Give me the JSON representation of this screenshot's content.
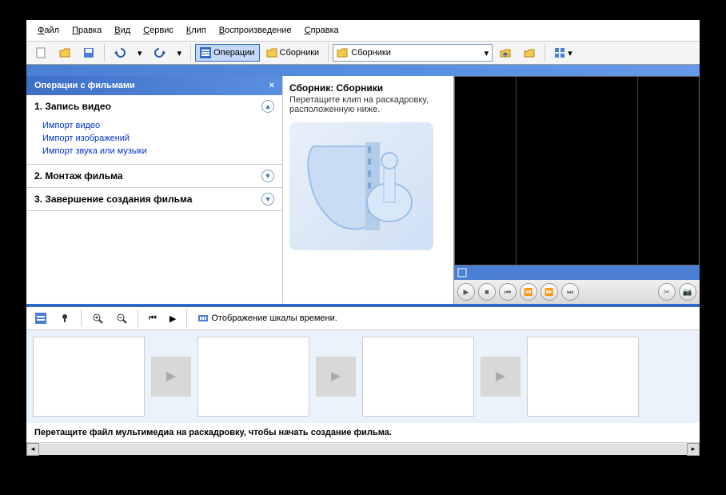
{
  "menu": {
    "file": "Файл",
    "edit": "Правка",
    "view": "Вид",
    "service": "Сервис",
    "clip": "Клип",
    "play": "Воспроизведение",
    "help": "Справка"
  },
  "toolbar": {
    "operations": "Операции",
    "collections": "Сборники",
    "location_value": "Сборники"
  },
  "tasks": {
    "header": "Операции с фильмами",
    "group1": {
      "title": "1. Запись видео",
      "links": {
        "a": "Импорт видео",
        "b": "Импорт изображений",
        "c": "Импорт звука или музыки"
      }
    },
    "group2": {
      "title": "2. Монтаж фильма"
    },
    "group3": {
      "title": "3. Завершение создания фильма"
    }
  },
  "collection": {
    "title": "Сборник: Сборники",
    "subtitle": "Перетащите клип на раскадровку, расположенную ниже."
  },
  "timeline": {
    "toggle_label": "Отображение шкалы времени.",
    "hint": "Перетащите файл мультимедиа на раскадровку, чтобы начать создание фильма."
  }
}
